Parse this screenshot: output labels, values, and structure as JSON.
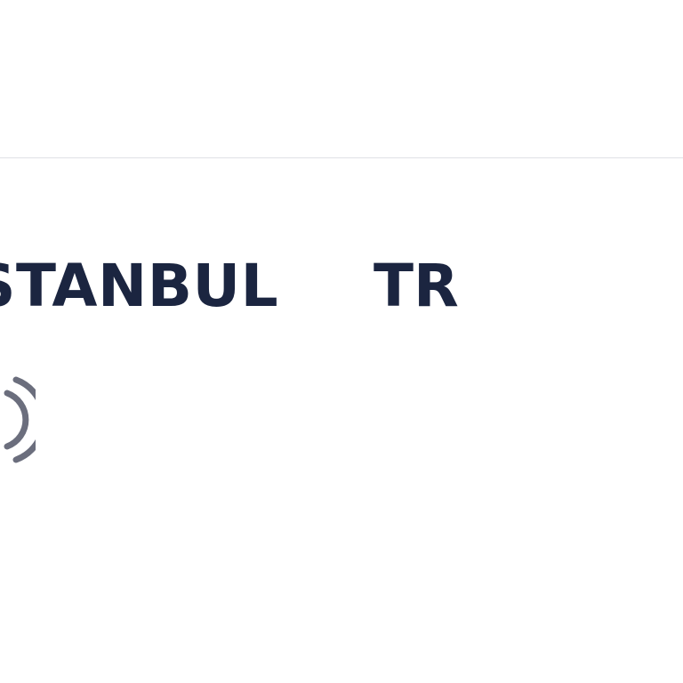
{
  "location": {
    "city": "STANBUL",
    "country": "TR"
  },
  "icons": {
    "broadcast": "broadcast-signal-icon"
  },
  "colors": {
    "text": "#1b2540",
    "icon": "#6b6e7d",
    "divider": "#dfe1e6",
    "background": "#ffffff"
  }
}
